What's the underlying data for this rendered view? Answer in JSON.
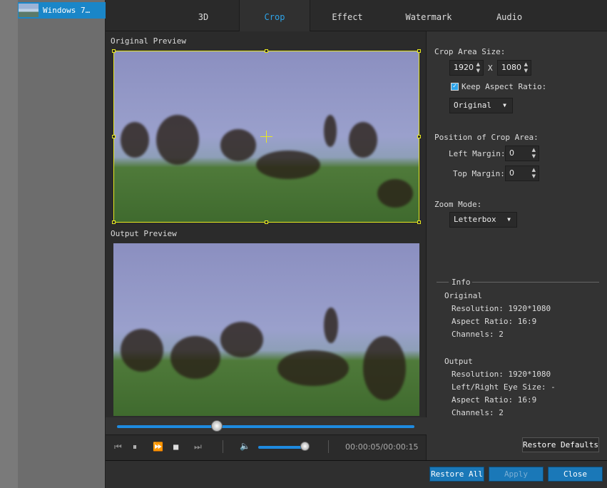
{
  "sidebar": {
    "file_name": "Windows 7…"
  },
  "tabs": [
    {
      "label": "3D"
    },
    {
      "label": "Crop",
      "active": true
    },
    {
      "label": "Effect"
    },
    {
      "label": "Watermark"
    },
    {
      "label": "Audio"
    }
  ],
  "preview": {
    "original_label": "Original Preview",
    "output_label": "Output Preview"
  },
  "player": {
    "time": "00:00:05/00:00:15",
    "progress_fraction": 0.33,
    "volume_fraction": 0.9
  },
  "crop": {
    "area_size_label": "Crop Area Size:",
    "width": "1920",
    "x_label": "X",
    "height": "1080",
    "keep_aspect_label": "Keep Aspect Ratio:",
    "keep_aspect_checked": true,
    "aspect_option": "Original",
    "position_label": "Position of Crop Area:",
    "left_margin_label": "Left Margin:",
    "left_margin": "0",
    "top_margin_label": "Top Margin:",
    "top_margin": "0",
    "zoom_mode_label": "Zoom Mode:",
    "zoom_mode": "Letterbox"
  },
  "info": {
    "title": "Info",
    "original_title": "Original",
    "original_resolution": "Resolution: 1920*1080",
    "original_aspect": "Aspect Ratio: 16:9",
    "original_channels": "Channels: 2",
    "output_title": "Output",
    "output_resolution": "Resolution: 1920*1080",
    "output_eye": "Left/Right Eye Size: -",
    "output_aspect": "Aspect Ratio: 16:9",
    "output_channels": "Channels: 2"
  },
  "buttons": {
    "restore_defaults": "Restore Defaults",
    "restore_all": "Restore All",
    "apply": "Apply",
    "close": "Close"
  },
  "colors": {
    "accent": "#2ea3e8",
    "button_blue": "#1a78b8",
    "crop_frame": "#e8e820"
  }
}
